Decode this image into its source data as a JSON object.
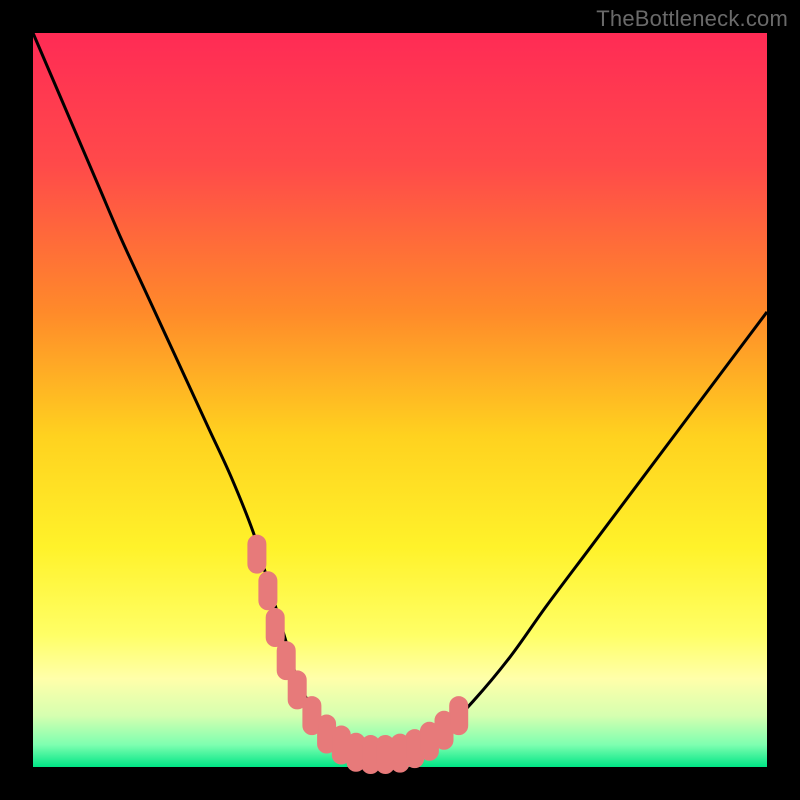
{
  "watermark": "TheBottleneck.com",
  "colors": {
    "background": "#000000",
    "gradient_stops": [
      {
        "pct": 0,
        "color": "#ff2b55"
      },
      {
        "pct": 18,
        "color": "#ff4a4a"
      },
      {
        "pct": 38,
        "color": "#ff8a2a"
      },
      {
        "pct": 55,
        "color": "#ffd21f"
      },
      {
        "pct": 70,
        "color": "#fff22a"
      },
      {
        "pct": 82,
        "color": "#ffff66"
      },
      {
        "pct": 88,
        "color": "#ffffaa"
      },
      {
        "pct": 93,
        "color": "#d6ffb0"
      },
      {
        "pct": 97,
        "color": "#7dffb0"
      },
      {
        "pct": 100,
        "color": "#00e585"
      }
    ],
    "curve": "#000000",
    "marker_fill": "#e77a7a",
    "marker_stroke": "#e77a7a"
  },
  "chart_data": {
    "type": "line",
    "title": "",
    "xlabel": "",
    "ylabel": "",
    "xlim": [
      0,
      100
    ],
    "ylim": [
      0,
      100
    ],
    "grid": false,
    "series": [
      {
        "name": "bottleneck-curve",
        "x": [
          0,
          3,
          6,
          9,
          12,
          15,
          18,
          21,
          24,
          27,
          30,
          31.5,
          33,
          34.5,
          36,
          38,
          40,
          42,
          44,
          46,
          48,
          52,
          56,
          60,
          65,
          70,
          76,
          82,
          88,
          94,
          100
        ],
        "y": [
          100,
          93,
          86,
          79,
          72,
          65.5,
          59,
          52.5,
          46,
          39.5,
          32,
          27,
          22,
          17,
          12,
          8,
          5,
          3,
          2,
          1.5,
          1.5,
          2.5,
          5,
          9,
          15,
          22,
          30,
          38,
          46,
          54,
          62
        ]
      }
    ],
    "markers": {
      "name": "highlighted-points",
      "x": [
        30.5,
        32.0,
        33.0,
        34.5,
        36.0,
        38.0,
        40.0,
        42.0,
        44.0,
        46.0,
        48.0,
        50.0,
        52.0,
        54.0,
        56.0,
        58.0
      ],
      "y": [
        29.0,
        24.0,
        19.0,
        14.5,
        10.5,
        7.0,
        4.5,
        3.0,
        2.0,
        1.7,
        1.7,
        1.9,
        2.5,
        3.5,
        5.0,
        7.0
      ]
    }
  }
}
